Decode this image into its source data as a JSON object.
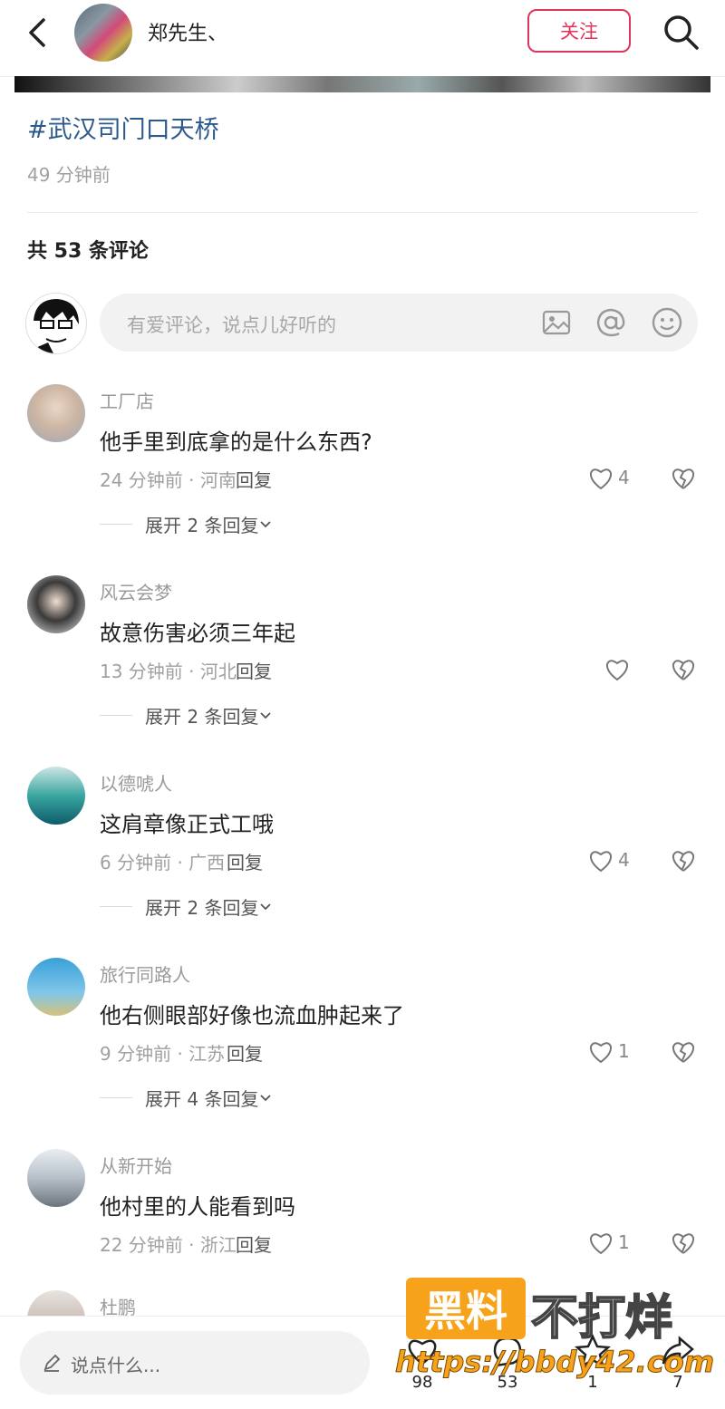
{
  "header": {
    "author_name": "郑先生、",
    "follow_label": "关注"
  },
  "post": {
    "hashtag": "#武汉司门口天桥",
    "time": "49 分钟前"
  },
  "comments_section": {
    "count_label": "共 53 条评论",
    "input_placeholder": "有爱评论，说点儿好听的"
  },
  "comments": [
    {
      "user": "工厂店",
      "text": "他手里到底拿的是什么东西?",
      "meta": "24 分钟前 · 河南",
      "reply": "回复",
      "likes": "4",
      "expand": "展开 2 条回复"
    },
    {
      "user": "风云会梦",
      "text": "故意伤害必须三年起",
      "meta": "13 分钟前 · 河北",
      "reply": "回复",
      "likes": "",
      "expand": "展开 2 条回复"
    },
    {
      "user": "以德唬人",
      "text": "这肩章像正式工哦",
      "meta": "6 分钟前 · 广西",
      "reply": "回复",
      "likes": "4",
      "expand": "展开 2 条回复"
    },
    {
      "user": "旅行同路人",
      "text": "他右侧眼部好像也流血肿起来了",
      "meta": "9 分钟前 · 江苏",
      "reply": "回复",
      "likes": "1",
      "expand": "展开 4 条回复"
    },
    {
      "user": "从新开始",
      "text": "他村里的人能看到吗",
      "meta": "22 分钟前 · 浙江",
      "reply": "回复",
      "likes": "1",
      "expand": ""
    },
    {
      "user": "杜鹏",
      "text": "",
      "meta": "",
      "reply": "",
      "likes": "",
      "expand": ""
    }
  ],
  "bottom_bar": {
    "say_placeholder": "说点什么...",
    "stats": [
      "98",
      "53",
      "1",
      "7"
    ]
  },
  "watermark": {
    "brand_box": "黑料",
    "brand_text": "不打烊",
    "url": "https://bbdy42.com"
  },
  "colors": {
    "accent": "#e0345a",
    "hashtag": "#2d5a8c",
    "watermark": "#f7a21b"
  }
}
